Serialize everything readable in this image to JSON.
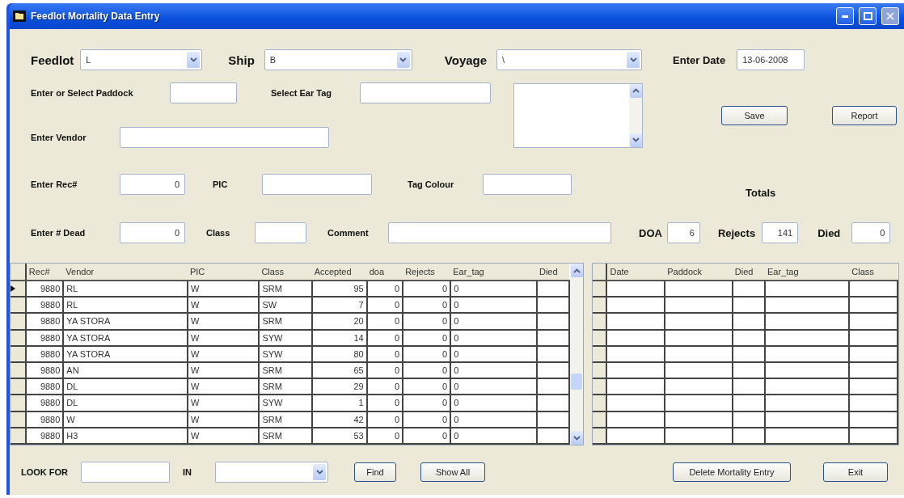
{
  "window": {
    "title": "Feedlot Mortality Data Entry"
  },
  "filters": [
    {
      "label": "Feedlot",
      "value": "L"
    },
    {
      "label": "Ship",
      "value": "B"
    },
    {
      "label": "Voyage",
      "value": "\\"
    }
  ],
  "date": {
    "label": "Enter Date",
    "value": "13-06-2008"
  },
  "form": {
    "paddock_label": "Enter or Select Paddock",
    "ear_tag_label": "Select Ear Tag",
    "vendor_label": "Enter Vendor",
    "rec_label": "Enter Rec#",
    "rec_value": "0",
    "pic_label": "PIC",
    "tag_colour_label": "Tag Colour",
    "dead_label": "Enter # Dead",
    "dead_value": "0",
    "class_label": "Class",
    "comment_label": "Comment"
  },
  "buttons": {
    "save": "Save",
    "report": "Report"
  },
  "totals": {
    "title": "Totals",
    "items": [
      {
        "label": "DOA",
        "value": "6"
      },
      {
        "label": "Rejects",
        "value": "141"
      },
      {
        "label": "Died",
        "value": "0"
      }
    ]
  },
  "mortality_grid": {
    "columns": [
      "Rec#",
      "Vendor",
      "PIC",
      "Class",
      "Accepted",
      "doa",
      "Rejects",
      "Ear_tag",
      "Died"
    ],
    "rows": [
      {
        "selected": true,
        "cells": [
          "9880",
          "RL",
          "W",
          "SRM",
          "95",
          "0",
          "0",
          "0",
          ""
        ]
      },
      {
        "selected": false,
        "cells": [
          "9880",
          "RL",
          "W",
          "SW",
          "7",
          "0",
          "0",
          "0",
          ""
        ]
      },
      {
        "selected": false,
        "cells": [
          "9880",
          "YA   STORA",
          "W",
          "SRM",
          "20",
          "0",
          "0",
          "0",
          ""
        ]
      },
      {
        "selected": false,
        "cells": [
          "9880",
          "YA   STORA",
          "W",
          "SYW",
          "14",
          "0",
          "0",
          "0",
          ""
        ]
      },
      {
        "selected": false,
        "cells": [
          "9880",
          "YA   STORA",
          "W",
          "SYW",
          "80",
          "0",
          "0",
          "0",
          ""
        ]
      },
      {
        "selected": false,
        "cells": [
          "9880",
          "AN",
          "W",
          "SRM",
          "65",
          "0",
          "0",
          "0",
          ""
        ]
      },
      {
        "selected": false,
        "cells": [
          "9880",
          "DL",
          "W",
          "SRM",
          "29",
          "0",
          "0",
          "0",
          ""
        ]
      },
      {
        "selected": false,
        "cells": [
          "9880",
          "DL",
          "W",
          "SYW",
          "1",
          "0",
          "0",
          "0",
          ""
        ]
      },
      {
        "selected": false,
        "cells": [
          "9880",
          "W",
          "W",
          "SRM",
          "42",
          "0",
          "0",
          "0",
          ""
        ]
      },
      {
        "selected": false,
        "cells": [
          "9880",
          "H3",
          "W",
          "SRM",
          "53",
          "0",
          "0",
          "0",
          ""
        ]
      }
    ]
  },
  "entries_grid": {
    "columns": [
      "Date",
      "Paddock",
      "Died",
      "Ear_tag",
      "Class"
    ]
  },
  "footer": {
    "look_for_label": "LOOK FOR",
    "in_label": "IN",
    "find": "Find",
    "show_all": "Show All",
    "delete": "Delete Mortality Entry",
    "exit": "Exit"
  }
}
